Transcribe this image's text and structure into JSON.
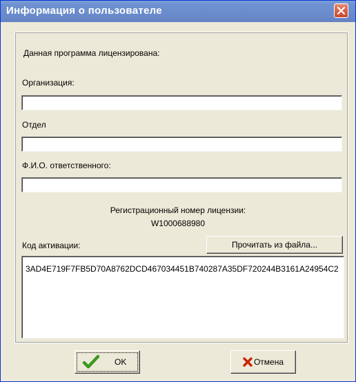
{
  "window": {
    "title": "Информация о пользователе"
  },
  "license_group": {
    "title": "Данная программа лицензирована:"
  },
  "fields": {
    "organization": {
      "label": "Организация:",
      "value": ""
    },
    "department": {
      "label": "Отдел",
      "value": ""
    },
    "responsible": {
      "label": "Ф.И.О. ответственного:",
      "value": ""
    }
  },
  "registration": {
    "label": "Регистрационный номер лицензии:",
    "number": "W1000688980"
  },
  "activation": {
    "label": "Код активации:",
    "read_button": "Прочитать из файла...",
    "code": "3AD4E719F7FB5D70A8762DCD467034451B740287A35DF720244B3161A24954C2"
  },
  "buttons": {
    "ok": "OK",
    "cancel": "Отмена"
  },
  "colors": {
    "titlebar": "#6b8ccc",
    "dialog_bg": "#ece9d8",
    "ok_check": "#3a9a1e",
    "cancel_x": "#cc2200"
  },
  "icons": [
    "close-icon",
    "checkmark-icon",
    "cross-icon"
  ]
}
